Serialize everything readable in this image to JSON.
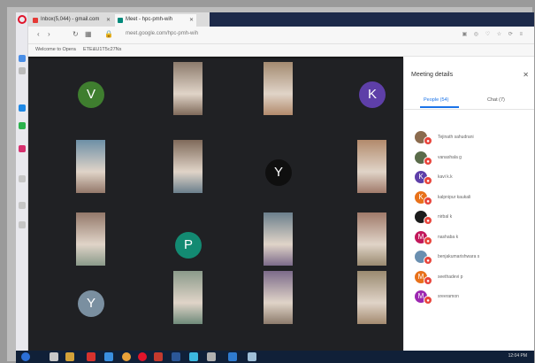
{
  "browser": {
    "tabs": [
      {
        "label": "Inbox(5,044) - gmail.com"
      },
      {
        "label": "Meet - hpc-pmh-wih"
      }
    ],
    "url": "meet.google.com/hpc-pmh-wih",
    "bookmarks": [
      "Welcome to Opera",
      "ETE&U1T5c27Ns"
    ]
  },
  "meet": {
    "tiles": [
      {
        "type": "letter",
        "letter": "V",
        "color": "#3f7e2f"
      },
      {
        "type": "video"
      },
      {
        "type": "video"
      },
      {
        "type": "letter",
        "letter": "K",
        "color": "#5e3fa8"
      },
      {
        "type": "video"
      },
      {
        "type": "video"
      },
      {
        "type": "letter",
        "letter": "Y",
        "color": "#0f0f0f"
      },
      {
        "type": "video"
      },
      {
        "type": "video"
      },
      {
        "type": "letter",
        "letter": "P",
        "color": "#138a72"
      },
      {
        "type": "video"
      },
      {
        "type": "video"
      },
      {
        "type": "letter",
        "letter": "Y",
        "color": "#7a8fa0"
      },
      {
        "type": "video"
      },
      {
        "type": "video"
      },
      {
        "type": "video"
      }
    ]
  },
  "panel": {
    "title": "Meeting details",
    "close": "✕",
    "tab_people": "People (54)",
    "tab_chat": "Chat (7)",
    "people": [
      {
        "initial": "",
        "color": "#8b6b4e",
        "name": "Tejinath sahudrani"
      },
      {
        "initial": "",
        "color": "#5a6b4a",
        "name": "vanashala g"
      },
      {
        "initial": "K",
        "color": "#5e3fa8",
        "name": "kavi k.k"
      },
      {
        "initial": "K",
        "color": "#e8711a",
        "name": "kalpnipur kaukali"
      },
      {
        "initial": "",
        "color": "#1c1c1c",
        "name": "nirbal k"
      },
      {
        "initial": "M",
        "color": "#c2185b",
        "name": "nashaba k"
      },
      {
        "initial": "",
        "color": "#6a8fb0",
        "name": "benjakumarishwara s"
      },
      {
        "initial": "M",
        "color": "#e8711a",
        "name": "seethadevi p"
      },
      {
        "initial": "M",
        "color": "#9c27b0",
        "name": "sreeramon"
      }
    ]
  },
  "taskbar": {
    "tray_text": "12:04 PM"
  }
}
